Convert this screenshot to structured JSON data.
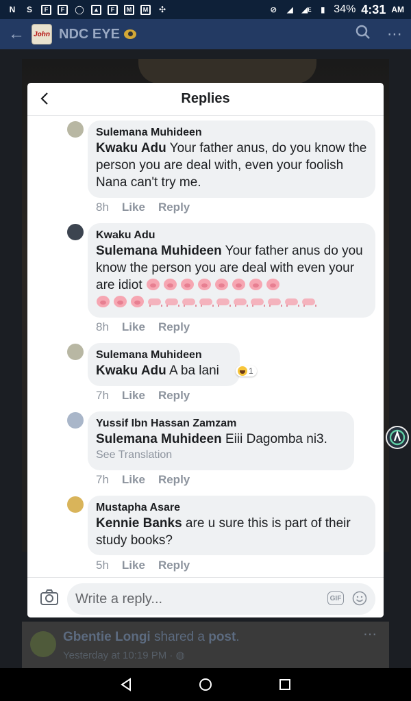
{
  "status_bar": {
    "left_icons": [
      "n-icon",
      "skype-icon",
      "flipboard-icon",
      "flipboard-icon",
      "whatsapp-icon",
      "image-icon",
      "flipboard-icon",
      "gmail-icon",
      "gmail-icon",
      "pinwheel-icon"
    ],
    "battery": "34%",
    "network": "E",
    "time": "4:31",
    "ampm": "AM"
  },
  "app_bar": {
    "title": "NDC EYE",
    "logo_text": "John"
  },
  "modal": {
    "title": "Replies",
    "replies": [
      {
        "author": "Sulemana Muhideen",
        "mention": "Kwaku Adu",
        "text": " Your father anus, do you know the person you  are deal with, even your foolish Nana can't try me.",
        "time": "8h",
        "like": "Like",
        "reply": "Reply",
        "avatar_color": "#b8b7a3"
      },
      {
        "author": "Kwaku Adu",
        "mention": "Sulemana Muhideen",
        "text": " Your father anus do you know the person you are deal with even your are idiot",
        "emoji_pig_faces": 11,
        "emoji_pigs": 10,
        "time": "8h",
        "like": "Like",
        "reply": "Reply",
        "avatar_color": "#3c4450"
      },
      {
        "author": "Sulemana Muhideen",
        "mention": "Kwaku Adu",
        "text": " A ba lani",
        "reaction_count": "1",
        "time": "7h",
        "like": "Like",
        "reply": "Reply",
        "avatar_color": "#b8b7a3"
      },
      {
        "author": "Yussif Ibn Hassan Zamzam",
        "mention": "Sulemana Muhideen",
        "text": " Eiii Dagomba ni3.",
        "translate": "See Translation",
        "time": "7h",
        "like": "Like",
        "reply": "Reply",
        "avatar_color": "#a9b6c9"
      },
      {
        "author": "Mustapha Asare",
        "mention": "Kennie Banks",
        "text": " are u sure this is part of their study books?",
        "time": "5h",
        "like": "Like",
        "reply": "Reply",
        "avatar_color": "#d9b45a"
      }
    ],
    "composer": {
      "placeholder": "Write a reply...",
      "gif_label": "GIF"
    }
  },
  "background_post": {
    "author": "Gbentie Longi",
    "action": " shared a ",
    "object": "post",
    "period": ".",
    "timestamp": "Yesterday at 10:19 PM · "
  }
}
